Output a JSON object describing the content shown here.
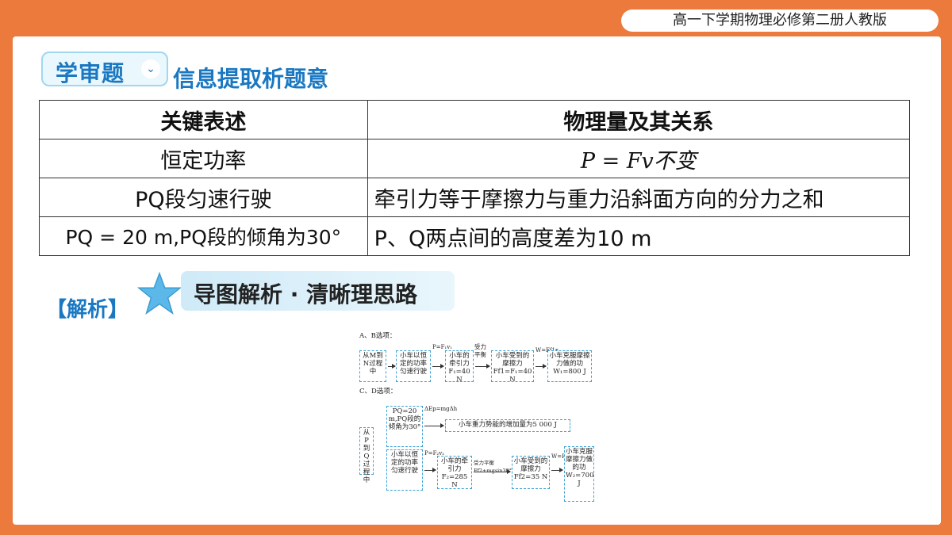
{
  "header": {
    "course_title": "高一下学期物理必修第二册人教版"
  },
  "section": {
    "badge_label": "学审题",
    "subtitle": "信息提取析题意"
  },
  "table": {
    "headers": [
      "关键表述",
      "物理量及其关系"
    ],
    "rows": [
      [
        "恒定功率",
        "P = Fv不变"
      ],
      [
        "PQ段匀速行驶",
        "牵引力等于摩擦力与重力沿斜面方向的分力之和"
      ],
      [
        "PQ = 20 m,PQ段的倾角为30°",
        "P、Q两点间的高度差为10 m"
      ]
    ]
  },
  "analysis": {
    "label": "【解析】",
    "guide_title": "导图解析 · 清晰理思路"
  },
  "diagram": {
    "ab_title": "A、B选项：",
    "cd_title": "C、D选项：",
    "ab": {
      "box1": "从M到N过程中",
      "box2": "小车以恒定的功率匀速行驶",
      "arrow2": "P=F₁v₁",
      "box3": "小车的牵引力F₁=40 N",
      "arrow3": "受力平衡",
      "box4": "小车受到的摩擦力Ff1=F₁=40 N",
      "arrow4": "W=Ff1x",
      "box5": "小车克服摩擦力做的功W₁=800 J"
    },
    "cd": {
      "box1": "从P到Q过程中",
      "box_top": "PQ=20 m,PQ段的倾角为30°",
      "arrow_top": "ΔEp=mgΔh",
      "box_top_result": "小车重力势能的增加量为5 000 J",
      "box2": "小车以恒定的功率匀速行驶",
      "arrow2": "P=F₂v₂",
      "box3": "小车的牵引力F₂=285 N",
      "arrow3": "受力平衡 Ff2+mgsin30°=F₂",
      "box4": "小车受到的摩擦力Ff2=35 N",
      "arrow4": "W=Ff2x",
      "box5": "小车克服摩擦力做的功W₂=700 J"
    }
  }
}
